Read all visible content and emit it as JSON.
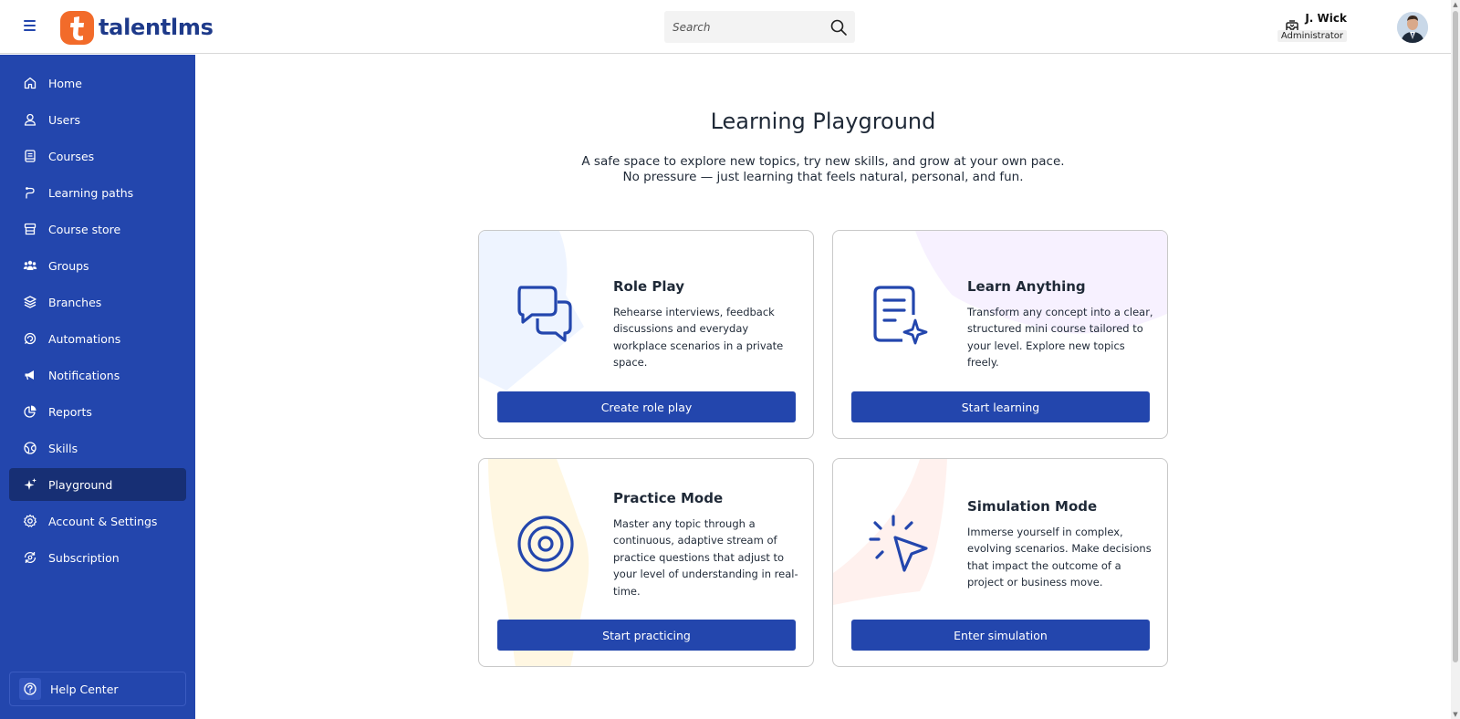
{
  "header": {
    "logo_text": "talentlms",
    "search_placeholder": "Search",
    "user_name": "J. Wick",
    "user_role": "Administrator"
  },
  "sidebar": {
    "items": [
      {
        "label": "Home",
        "icon": "home-icon"
      },
      {
        "label": "Users",
        "icon": "user-icon"
      },
      {
        "label": "Courses",
        "icon": "book-icon"
      },
      {
        "label": "Learning paths",
        "icon": "path-icon"
      },
      {
        "label": "Course store",
        "icon": "store-icon"
      },
      {
        "label": "Groups",
        "icon": "groups-icon"
      },
      {
        "label": "Branches",
        "icon": "layers-icon"
      },
      {
        "label": "Automations",
        "icon": "automation-icon"
      },
      {
        "label": "Notifications",
        "icon": "megaphone-icon"
      },
      {
        "label": "Reports",
        "icon": "pie-chart-icon"
      },
      {
        "label": "Skills",
        "icon": "globe-icon"
      },
      {
        "label": "Playground",
        "icon": "sparkle-icon",
        "active": true
      },
      {
        "label": "Account & Settings",
        "icon": "gear-icon"
      },
      {
        "label": "Subscription",
        "icon": "refresh-gear-icon"
      }
    ],
    "help_label": "Help Center"
  },
  "main": {
    "title": "Learning Playground",
    "subtitle_line1": "A safe space to explore new topics, try new skills, and grow at your own pace.",
    "subtitle_line2": "No pressure — just learning that feels natural, personal, and fun.",
    "cards": [
      {
        "title": "Role Play",
        "description": "Rehearse interviews, feedback discussions and everyday workplace scenarios in a private space.",
        "button": "Create role play",
        "icon": "chat-bubbles-icon",
        "accent": "#eaf1ff"
      },
      {
        "title": "Learn Anything",
        "description": "Transform any concept into a clear, structured mini course tailored to your level. Explore new topics freely.",
        "button": "Start learning",
        "icon": "document-sparkle-icon",
        "accent": "#f6efff"
      },
      {
        "title": "Practice Mode",
        "description": "Master any topic through a continuous, adaptive stream of practice questions that adjust to your level of understanding in real-time.",
        "button": "Start practicing",
        "icon": "target-icon",
        "accent": "#fff6df"
      },
      {
        "title": "Simulation Mode",
        "description": "Immerse yourself in complex, evolving scenarios. Make decisions that impact the outcome of a project or business move.",
        "button": "Enter simulation",
        "icon": "cursor-click-icon",
        "accent": "#fff0ec"
      }
    ]
  },
  "colors": {
    "brand_blue": "#2346ad",
    "active_blue": "#172f74",
    "logo_orange": "#f26b2a"
  }
}
